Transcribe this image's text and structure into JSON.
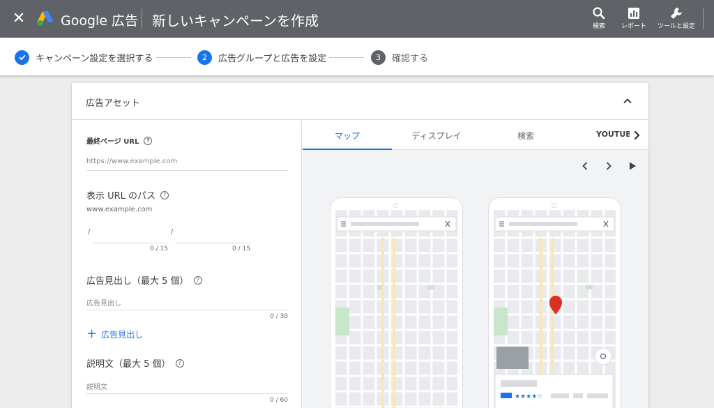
{
  "header": {
    "close_icon": "close-icon",
    "brand": "Google 広告",
    "page_title": "新しいキャンペーンを作成",
    "tools": [
      {
        "label": "検索",
        "icon": "search-icon"
      },
      {
        "label": "レポート",
        "icon": "report-icon"
      },
      {
        "label": "ツールと設定",
        "icon": "wrench-icon"
      }
    ]
  },
  "stepper": {
    "steps": [
      {
        "number": "",
        "label": "キャンペーン設定を選択する",
        "state": "complete"
      },
      {
        "number": "2",
        "label": "広告グループと広告を設定",
        "state": "current"
      },
      {
        "number": "3",
        "label": "確認する",
        "state": "upcoming"
      }
    ]
  },
  "card": {
    "title": "広告アセット",
    "form": {
      "final_url": {
        "label": "最終ページ URL",
        "placeholder": "https://www.example.com"
      },
      "display_path": {
        "label": "表示 URL のパス",
        "base": "www.example.com",
        "slash": "/",
        "counter1": "0 / 15",
        "counter2": "0 / 15"
      },
      "headlines": {
        "label": "広告見出し（最大 5 個）",
        "placeholder": "広告見出し",
        "counter": "0 / 30",
        "add_label": "広告見出し"
      },
      "descriptions": {
        "label": "説明文（最大 5 個）",
        "placeholder": "説明文",
        "counter": "0 / 60"
      }
    },
    "preview": {
      "tabs": [
        "マップ",
        "ディスプレイ",
        "検索",
        "YOUTUBE"
      ],
      "active_tab": "マップ",
      "rating_stars": "★★★★☆"
    }
  },
  "colors": {
    "topbar": "#5f6368",
    "accent": "#1a73e8",
    "pin": "#d93025",
    "map_green": "#c8e6c9"
  }
}
